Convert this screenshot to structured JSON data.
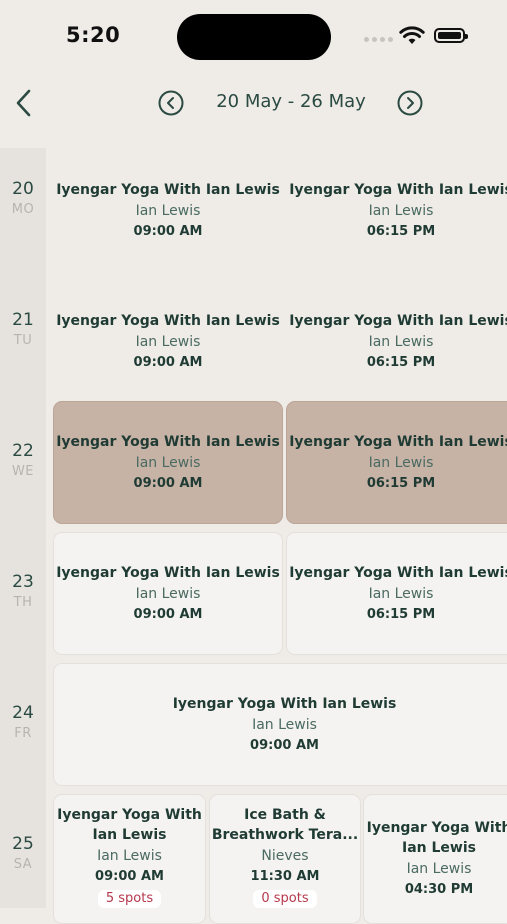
{
  "status": {
    "time": "5:20"
  },
  "header": {
    "date_range": "20 May - 26 May"
  },
  "days": [
    {
      "num": "20",
      "abbr": "MO"
    },
    {
      "num": "21",
      "abbr": "TU"
    },
    {
      "num": "22",
      "abbr": "WE"
    },
    {
      "num": "23",
      "abbr": "TH"
    },
    {
      "num": "24",
      "abbr": "FR"
    },
    {
      "num": "25",
      "abbr": "SA"
    }
  ],
  "classes": {
    "mo_am": {
      "title": "Iyengar Yoga With Ian Lewis",
      "instructor": "Ian Lewis",
      "time": "09:00 AM"
    },
    "mo_pm": {
      "title": "Iyengar Yoga With Ian Lewis",
      "instructor": "Ian Lewis",
      "time": "06:15 PM"
    },
    "tu_am": {
      "title": "Iyengar Yoga With Ian Lewis",
      "instructor": "Ian Lewis",
      "time": "09:00 AM"
    },
    "tu_pm": {
      "title": "Iyengar Yoga With Ian Lewis",
      "instructor": "Ian Lewis",
      "time": "06:15 PM"
    },
    "we_am": {
      "title": "Iyengar Yoga With Ian Lewis",
      "instructor": "Ian Lewis",
      "time": "09:00 AM"
    },
    "we_pm": {
      "title": "Iyengar Yoga With Ian Lewis",
      "instructor": "Ian Lewis",
      "time": "06:15 PM"
    },
    "th_am": {
      "title": "Iyengar Yoga With Ian Lewis",
      "instructor": "Ian Lewis",
      "time": "09:00 AM"
    },
    "th_pm": {
      "title": "Iyengar Yoga With Ian Lewis",
      "instructor": "Ian Lewis",
      "time": "06:15 PM"
    },
    "fr_am": {
      "title": "Iyengar Yoga With Ian Lewis",
      "instructor": "Ian Lewis",
      "time": "09:00 AM"
    },
    "sa_1": {
      "title": "Iyengar Yoga With\nIan Lewis",
      "instructor": "Ian Lewis",
      "time": "09:00 AM",
      "spots": "5 spots"
    },
    "sa_2": {
      "title": "Ice Bath &\nBreathwork Tera...",
      "instructor": "Nieves",
      "time": "11:30 AM",
      "spots": "0 spots"
    },
    "sa_3": {
      "title": "Iyengar Yoga With\nIan Lewis",
      "instructor": "Ian Lewis",
      "time": "04:30 PM"
    }
  }
}
